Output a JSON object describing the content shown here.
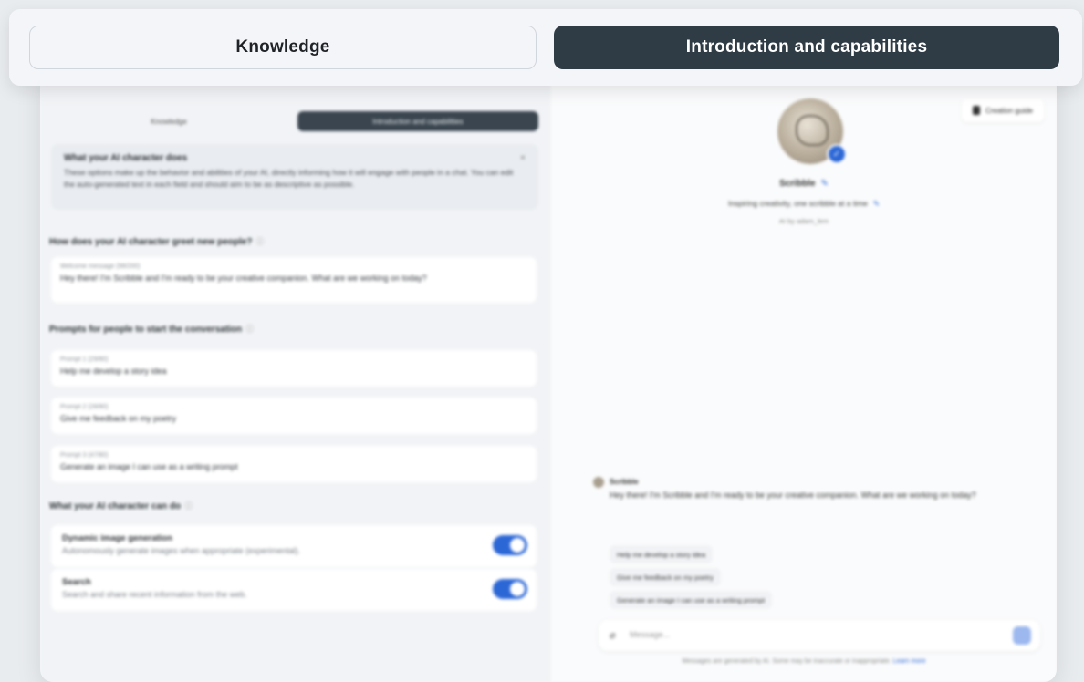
{
  "top_tabs": {
    "knowledge": "Knowledge",
    "intro": "Introduction and capabilities"
  },
  "left": {
    "mini_tabs": {
      "knowledge": "Knowledge",
      "intro": "Introduction and capabilities"
    },
    "info": {
      "title": "What your AI character does",
      "description": "These options make up the behavior and abilities of your AI, directly informing how it will engage with people in a chat. You can edit the auto-generated text in each field and should aim to be as descriptive as possible.",
      "close": "×"
    },
    "greet": {
      "title": "How does your AI character greet new people?",
      "info_icon": "ⓘ",
      "field_label": "Welcome message (98/200)",
      "field_value": "Hey there! I'm Scribble and I'm ready to be your creative companion. What are we working on today?"
    },
    "prompts": {
      "title": "Prompts for people to start the conversation",
      "info_icon": "ⓘ",
      "items": [
        {
          "label": "Prompt 1 (29/80)",
          "value": "Help me develop a story idea"
        },
        {
          "label": "Prompt 2 (28/80)",
          "value": "Give me feedback on my poetry"
        },
        {
          "label": "Prompt 3 (47/80)",
          "value": "Generate an image I can use as a writing prompt"
        }
      ]
    },
    "capabilities": {
      "title": "What your AI character can do",
      "info_icon": "ⓘ",
      "items": [
        {
          "title": "Dynamic image generation",
          "description": "Autonomously generate images when appropriate (experimental)."
        },
        {
          "title": "Search",
          "description": "Search and share recent information from the web."
        }
      ]
    }
  },
  "right": {
    "guide_button": "Creation guide",
    "bot_name": "Scribble",
    "edit_icon": "✎",
    "tagline": "Inspiring creativity, one scribble at a time",
    "by_line": "AI by adam_lem",
    "verified_mark": "✓",
    "message": {
      "sender": "Scribble",
      "text": "Hey there! I'm Scribble and I'm ready to be your creative companion. What are we working on today?"
    },
    "chips": [
      "Help me develop a story idea",
      "Give me feedback on my poetry",
      "Generate an image I can use as a writing prompt"
    ],
    "input_placeholder": "Message...",
    "attach_icon": "⌀",
    "disclaimer": "Messages are generated by AI. Some may be inaccurate or inappropriate.",
    "learn_more": "Learn more"
  },
  "colors": {
    "accent": "#2c67d6",
    "dark_tab": "#2f3b45"
  }
}
